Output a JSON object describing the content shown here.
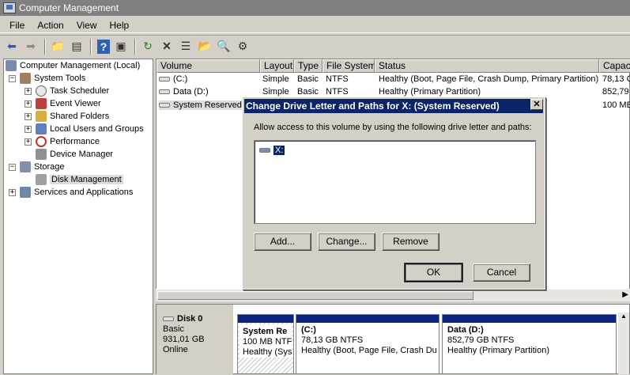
{
  "window": {
    "title": "Computer Management"
  },
  "menu": [
    "File",
    "Action",
    "View",
    "Help"
  ],
  "toolbar": [
    "back-arrow-icon",
    "forward-arrow-icon",
    "up-folder-icon",
    "show-hide-tree-icon",
    "help-icon",
    "console-icon",
    "refresh-icon",
    "delete-icon",
    "properties-icon",
    "open-folder-icon",
    "search-icon",
    "settings-icon"
  ],
  "tree": {
    "root": "Computer Management (Local)",
    "system_tools": "System Tools",
    "task_scheduler": "Task Scheduler",
    "event_viewer": "Event Viewer",
    "shared_folders": "Shared Folders",
    "local_users": "Local Users and Groups",
    "performance": "Performance",
    "device_manager": "Device Manager",
    "storage": "Storage",
    "disk_management": "Disk Management",
    "services": "Services and Applications"
  },
  "volumes": {
    "columns": [
      "Volume",
      "Layout",
      "Type",
      "File System",
      "Status",
      "Capaci"
    ],
    "rows": [
      {
        "volume": "(C:)",
        "layout": "Simple",
        "type": "Basic",
        "fs": "NTFS",
        "status": "Healthy (Boot, Page File, Crash Dump, Primary Partition)",
        "capacity": "78,13 G"
      },
      {
        "volume": "Data (D:)",
        "layout": "Simple",
        "type": "Basic",
        "fs": "NTFS",
        "status": "Healthy (Primary Partition)",
        "capacity": "852,79"
      },
      {
        "volume": "System Reserved (",
        "layout": "",
        "type": "",
        "fs": "",
        "status": "",
        "capacity": "100 MB"
      }
    ]
  },
  "disk": {
    "name": "Disk 0",
    "type": "Basic",
    "size": "931,01 GB",
    "state": "Online",
    "partitions": [
      {
        "name": "System Re",
        "size": "100 MB NTF:",
        "status": "Healthy (Sys"
      },
      {
        "name": "(C:)",
        "size": "78,13 GB NTFS",
        "status": "Healthy (Boot, Page File, Crash Du"
      },
      {
        "name": "Data  (D:)",
        "size": "852,79 GB NTFS",
        "status": "Healthy (Primary Partition)"
      }
    ]
  },
  "dialog": {
    "title": "Change Drive Letter and Paths for X: (System Reserved)",
    "description": "Allow access to this volume by using the following drive letter and paths:",
    "path_item": "X:",
    "add": "Add...",
    "change": "Change...",
    "remove": "Remove",
    "ok": "OK",
    "cancel": "Cancel",
    "close": "✕"
  }
}
